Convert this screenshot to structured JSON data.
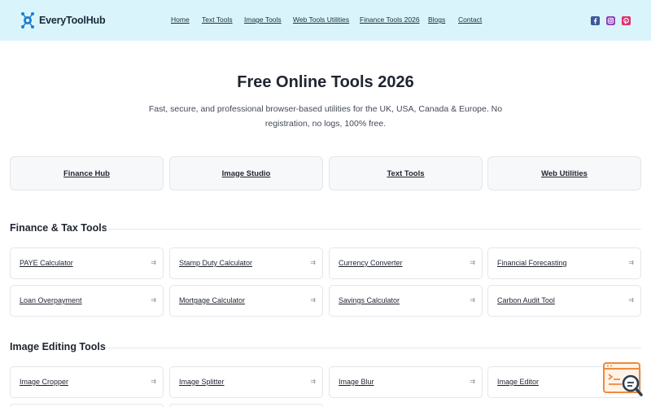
{
  "brand": {
    "name": "EveryToolHub"
  },
  "nav": [
    {
      "label": "Home"
    },
    {
      "label": "Text Tools"
    },
    {
      "label": "Image Tools"
    },
    {
      "label": "Web Tools Utilities"
    },
    {
      "label": "Finance Tools 2026"
    },
    {
      "label": "Blogs"
    },
    {
      "label": "Contact"
    }
  ],
  "social": [
    {
      "icon": "facebook-icon",
      "color": "#3b5998"
    },
    {
      "icon": "instagram-icon",
      "color": "#8a3ab9"
    },
    {
      "icon": "pinterest-icon",
      "color": "#e1306c"
    }
  ],
  "hero": {
    "title": "Free Online Tools 2026",
    "subtitle": "Fast, secure, and professional browser-based utilities for the UK, USA, Canada & Europe. No registration, no logs, 100% free."
  },
  "hubs": [
    {
      "label": "Finance Hub"
    },
    {
      "label": "Image Studio"
    },
    {
      "label": "Text Tools"
    },
    {
      "label": "Web Utilities"
    }
  ],
  "sections": [
    {
      "title": "Finance & Tax Tools",
      "tools": [
        {
          "label": "PAYE Calculator"
        },
        {
          "label": "Stamp Duty Calculator"
        },
        {
          "label": "Currency Converter"
        },
        {
          "label": "Financial Forecasting"
        },
        {
          "label": "Loan Overpayment"
        },
        {
          "label": "Mortgage Calculator"
        },
        {
          "label": "Savings Calculator"
        },
        {
          "label": "Carbon Audit Tool"
        }
      ]
    },
    {
      "title": "Image Editing Tools",
      "tools": [
        {
          "label": "Image Cropper"
        },
        {
          "label": "Image Splitter"
        },
        {
          "label": "Image Blur"
        },
        {
          "label": "Image Editor"
        }
      ]
    }
  ],
  "colors": {
    "header_bg": "#d9f4fb",
    "accent": "#1e7fd0",
    "float_icon": "#f08a3c"
  }
}
